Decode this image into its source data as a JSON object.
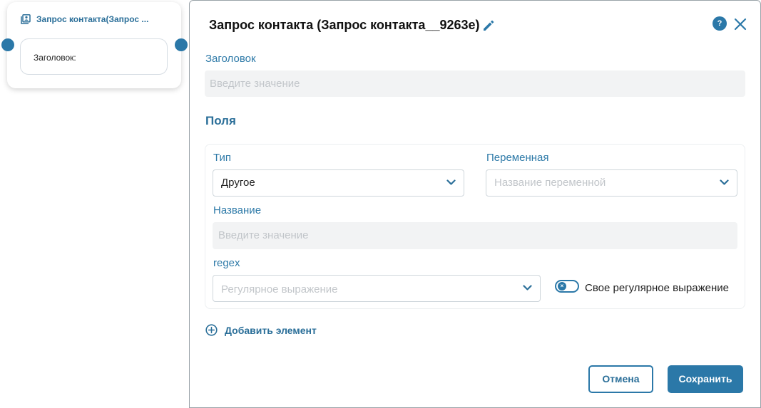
{
  "node": {
    "title": "Запрос контакта(Запрос ...",
    "field_label": "Заголовок:",
    "icon": "contact-card-icon"
  },
  "modal": {
    "title": "Запрос контакта (Запрос контакта__9263e)",
    "help_label": "?",
    "heading_label": "Заголовок",
    "heading_placeholder": "Введите значение",
    "section_title": "Поля",
    "fields": {
      "type_label": "Тип",
      "type_value": "Другое",
      "variable_label": "Переменная",
      "variable_placeholder": "Название переменной",
      "name_label": "Название",
      "name_placeholder": "Введите значение",
      "regex_label": "regex",
      "regex_placeholder": "Регулярное выражение",
      "custom_regex_label": "Свое регулярное выражение",
      "custom_regex_enabled": false
    },
    "add_element_label": "Добавить элемент",
    "cancel_label": "Отмена",
    "save_label": "Сохранить"
  },
  "colors": {
    "accent": "#2b78a8",
    "label": "#2e7aa8",
    "input_bg": "#f2f3f4",
    "placeholder": "#c2c6ca"
  }
}
